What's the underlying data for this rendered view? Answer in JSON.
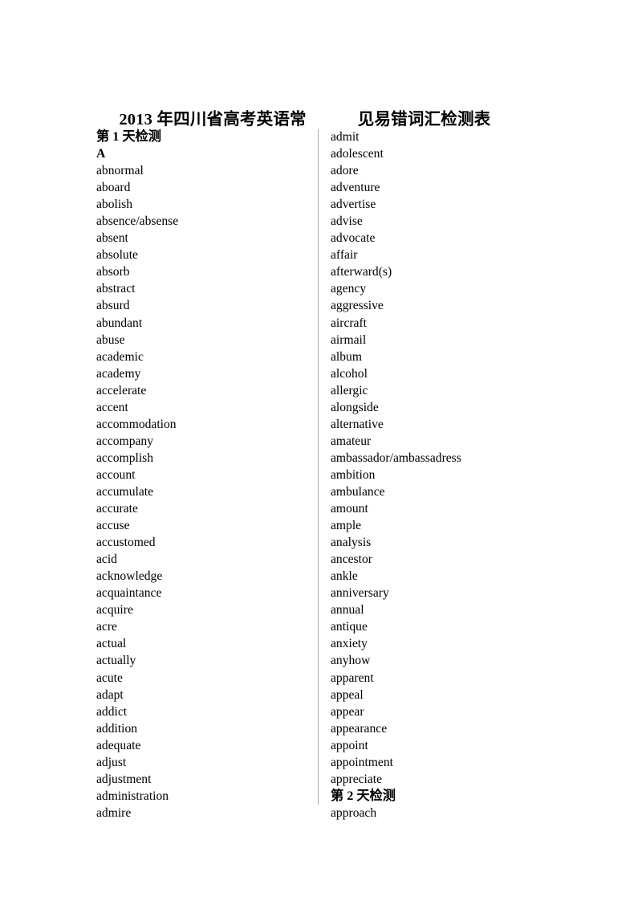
{
  "document": {
    "title_part_1": "2013 年四川省高考英语常",
    "title_part_2": "见易错词汇检测表",
    "page_background": "#ffffff",
    "text_color": "#000000",
    "divider_color": "#a8a8a8"
  },
  "columns": {
    "left": [
      {
        "text": "第 1 天检测",
        "style": "heading-cn"
      },
      {
        "text": "A",
        "style": "heading-letter"
      },
      {
        "text": "abnormal",
        "style": "word"
      },
      {
        "text": "aboard",
        "style": "word"
      },
      {
        "text": "abolish",
        "style": "word"
      },
      {
        "text": "absence/absense",
        "style": "word"
      },
      {
        "text": "absent",
        "style": "word"
      },
      {
        "text": "absolute",
        "style": "word"
      },
      {
        "text": "absorb",
        "style": "word"
      },
      {
        "text": "abstract",
        "style": "word"
      },
      {
        "text": "absurd",
        "style": "word"
      },
      {
        "text": "abundant",
        "style": "word"
      },
      {
        "text": "abuse",
        "style": "word"
      },
      {
        "text": "academic",
        "style": "word"
      },
      {
        "text": "academy",
        "style": "word"
      },
      {
        "text": "accelerate",
        "style": "word"
      },
      {
        "text": "accent",
        "style": "word"
      },
      {
        "text": "accommodation",
        "style": "word"
      },
      {
        "text": "accompany",
        "style": "word"
      },
      {
        "text": "accomplish",
        "style": "word"
      },
      {
        "text": "account",
        "style": "word"
      },
      {
        "text": "accumulate",
        "style": "word"
      },
      {
        "text": "accurate",
        "style": "word"
      },
      {
        "text": "accuse",
        "style": "word"
      },
      {
        "text": "accustomed",
        "style": "word"
      },
      {
        "text": "acid",
        "style": "word"
      },
      {
        "text": "acknowledge",
        "style": "word"
      },
      {
        "text": "acquaintance",
        "style": "word"
      },
      {
        "text": "acquire",
        "style": "word"
      },
      {
        "text": "acre",
        "style": "word"
      },
      {
        "text": "actual",
        "style": "word"
      },
      {
        "text": "actually",
        "style": "word"
      },
      {
        "text": "acute",
        "style": "word"
      },
      {
        "text": "adapt",
        "style": "word"
      },
      {
        "text": "addict",
        "style": "word"
      },
      {
        "text": "addition",
        "style": "word"
      },
      {
        "text": "adequate",
        "style": "word"
      },
      {
        "text": "adjust",
        "style": "word"
      },
      {
        "text": "adjustment",
        "style": "word"
      },
      {
        "text": "administration",
        "style": "word"
      },
      {
        "text": "admire",
        "style": "word"
      }
    ],
    "right": [
      {
        "text": "admit",
        "style": "word"
      },
      {
        "text": "adolescent",
        "style": "word"
      },
      {
        "text": "adore",
        "style": "word"
      },
      {
        "text": "adventure",
        "style": "word"
      },
      {
        "text": "advertise",
        "style": "word"
      },
      {
        "text": "advise",
        "style": "word"
      },
      {
        "text": "advocate",
        "style": "word"
      },
      {
        "text": "affair",
        "style": "word"
      },
      {
        "text": "afterward(s)",
        "style": "word"
      },
      {
        "text": "agency",
        "style": "word"
      },
      {
        "text": "aggressive",
        "style": "word"
      },
      {
        "text": "aircraft",
        "style": "word"
      },
      {
        "text": "airmail",
        "style": "word"
      },
      {
        "text": "album",
        "style": "word"
      },
      {
        "text": "alcohol",
        "style": "word"
      },
      {
        "text": "allergic",
        "style": "word"
      },
      {
        "text": "alongside",
        "style": "word"
      },
      {
        "text": "alternative",
        "style": "word"
      },
      {
        "text": "amateur",
        "style": "word"
      },
      {
        "text": "ambassador/ambassadress",
        "style": "word"
      },
      {
        "text": "ambition",
        "style": "word"
      },
      {
        "text": "ambulance",
        "style": "word"
      },
      {
        "text": "amount",
        "style": "word"
      },
      {
        "text": "ample",
        "style": "word"
      },
      {
        "text": "analysis",
        "style": "word"
      },
      {
        "text": "ancestor",
        "style": "word"
      },
      {
        "text": "ankle",
        "style": "word"
      },
      {
        "text": "anniversary",
        "style": "word"
      },
      {
        "text": "annual",
        "style": "word"
      },
      {
        "text": "antique",
        "style": "word"
      },
      {
        "text": "anxiety",
        "style": "word"
      },
      {
        "text": "anyhow",
        "style": "word"
      },
      {
        "text": "apparent",
        "style": "word"
      },
      {
        "text": "appeal",
        "style": "word"
      },
      {
        "text": "appear",
        "style": "word"
      },
      {
        "text": "appearance",
        "style": "word"
      },
      {
        "text": "appoint",
        "style": "word"
      },
      {
        "text": "appointment",
        "style": "word"
      },
      {
        "text": "appreciate",
        "style": "word"
      },
      {
        "text": "第 2 天检测",
        "style": "heading-cn"
      },
      {
        "text": "approach",
        "style": "word"
      }
    ]
  }
}
